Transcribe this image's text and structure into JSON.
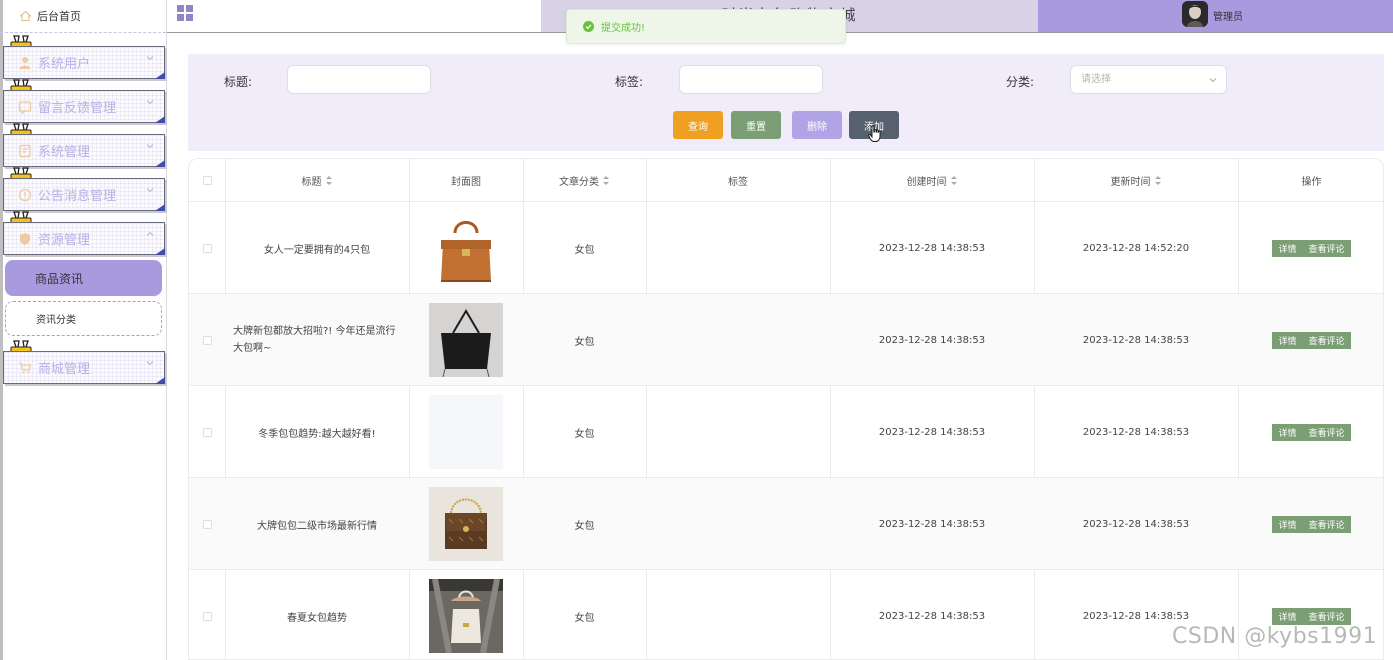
{
  "app": {
    "system_title": "时尚女包购物商城",
    "admin_name": "管理员"
  },
  "toast": {
    "message": "提交成功!"
  },
  "sidebar": {
    "home": "后台首页",
    "menus": [
      {
        "label": "系统用户",
        "icon": "user-icon"
      },
      {
        "label": "留言反馈管理",
        "icon": "message-icon"
      },
      {
        "label": "系统管理",
        "icon": "settings-doc-icon"
      },
      {
        "label": "公告消息管理",
        "icon": "info-circle-icon"
      },
      {
        "label": "资源管理",
        "icon": "shield-icon"
      },
      {
        "label": "商城管理",
        "icon": "cart-icon"
      }
    ],
    "active_sub": "商品资讯",
    "sub_item": "资讯分类"
  },
  "search": {
    "title_label": "标题:",
    "tag_label": "标签:",
    "category_label": "分类:",
    "category_placeholder": "请选择",
    "btn_query": "查询",
    "btn_reset": "重置",
    "btn_delete": "删除",
    "btn_add": "添加"
  },
  "table": {
    "headers": {
      "title": "标题",
      "cover": "封面图",
      "category": "文章分类",
      "tags": "标签",
      "created": "创建时间",
      "updated": "更新时间",
      "actions": "操作"
    },
    "rows": [
      {
        "title": "女人一定要拥有的4只包",
        "category": "女包",
        "tags": "",
        "created": "2023-12-28 14:38:53",
        "updated": "2023-12-28 14:52:20"
      },
      {
        "title": "大牌新包都放大招啦?! 今年还是流行大包啊~",
        "category": "女包",
        "tags": "",
        "created": "2023-12-28 14:38:53",
        "updated": "2023-12-28 14:38:53"
      },
      {
        "title": "冬季包包趋势:越大越好看!",
        "category": "女包",
        "tags": "",
        "created": "2023-12-28 14:38:53",
        "updated": "2023-12-28 14:38:53"
      },
      {
        "title": "大牌包包二级市场最新行情",
        "category": "女包",
        "tags": "",
        "created": "2023-12-28 14:38:53",
        "updated": "2023-12-28 14:38:53"
      },
      {
        "title": "春夏女包趋势",
        "category": "女包",
        "tags": "",
        "created": "2023-12-28 14:38:53",
        "updated": "2023-12-28 14:38:53"
      }
    ],
    "btn_detail": "详情",
    "btn_comments": "查看评论"
  },
  "watermark": "CSDN @kybs1991",
  "colors": {
    "accent_purple": "#a99ae0",
    "panel_bg": "#f1ecfa",
    "btn_query": "#f0a020",
    "btn_reset": "#7b9e75",
    "btn_delete": "#b1a4e6",
    "btn_add": "#56606e",
    "op_green": "#7b9e75"
  }
}
